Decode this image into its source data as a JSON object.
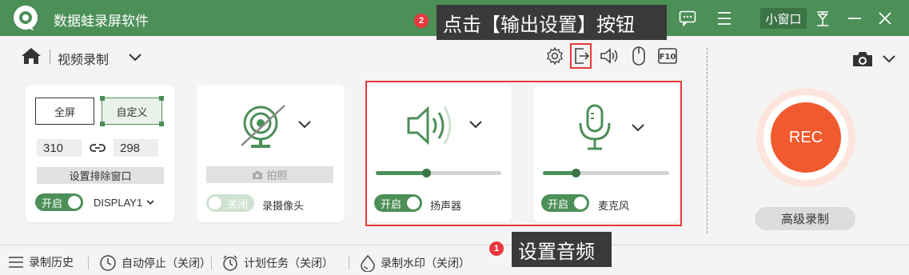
{
  "app": {
    "title": "数据蛙录屏软件",
    "mini_window": "小窗口"
  },
  "annotations": {
    "top_callout": "点击【输出设置】按钮",
    "top_badge": "2",
    "bottom_callout": "设置音频",
    "bottom_badge": "1"
  },
  "header": {
    "mode": "视频录制"
  },
  "screen_card": {
    "fullscreen": "全屏",
    "custom": "自定义",
    "width": "310",
    "height": "298",
    "exclude_btn": "设置排除窗口",
    "toggle": "开启",
    "display": "DISPLAY1"
  },
  "camera_card": {
    "snapshot": "拍照",
    "toggle": "关闭",
    "label": "录摄像头"
  },
  "speaker_card": {
    "toggle": "开启",
    "label": "扬声器",
    "volume": 0.4
  },
  "mic_card": {
    "toggle": "开启",
    "label": "麦克风",
    "volume": 0.26
  },
  "rec": {
    "label": "REC",
    "advanced": "高级录制"
  },
  "footer": {
    "history": "录制历史",
    "auto_stop": "自动停止（关闭）",
    "schedule": "计划任务（关闭）",
    "watermark": "录制水印（关闭）"
  },
  "colors": {
    "brand": "#4c8f57",
    "rec": "#f05a2e",
    "highlight": "#e53935"
  }
}
